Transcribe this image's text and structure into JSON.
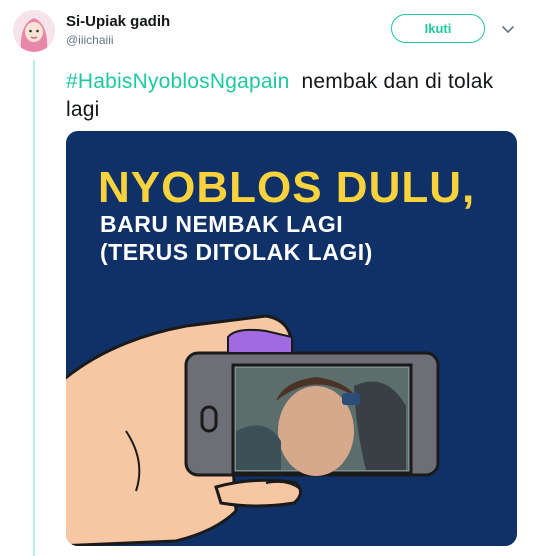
{
  "user": {
    "display_name": "Si-Upiak gadih",
    "handle": "@iiichaiii"
  },
  "follow_button": {
    "label": "Ikuti"
  },
  "tweet": {
    "hashtag": "#HabisNyoblosNgapain",
    "text": "nembak dan di tolak lagi"
  },
  "image": {
    "headline": "NYOBLOS DULU,",
    "subline_1": "BARU NEMBAK LAGI",
    "subline_2": "(TERUS DITOLAK LAGI)"
  },
  "colors": {
    "accent": "#1dcaa0",
    "image_background": "#0f3168",
    "headline": "#f9d23c"
  },
  "icons": {
    "caret": "chevron-down-icon",
    "avatar": "avatar"
  }
}
